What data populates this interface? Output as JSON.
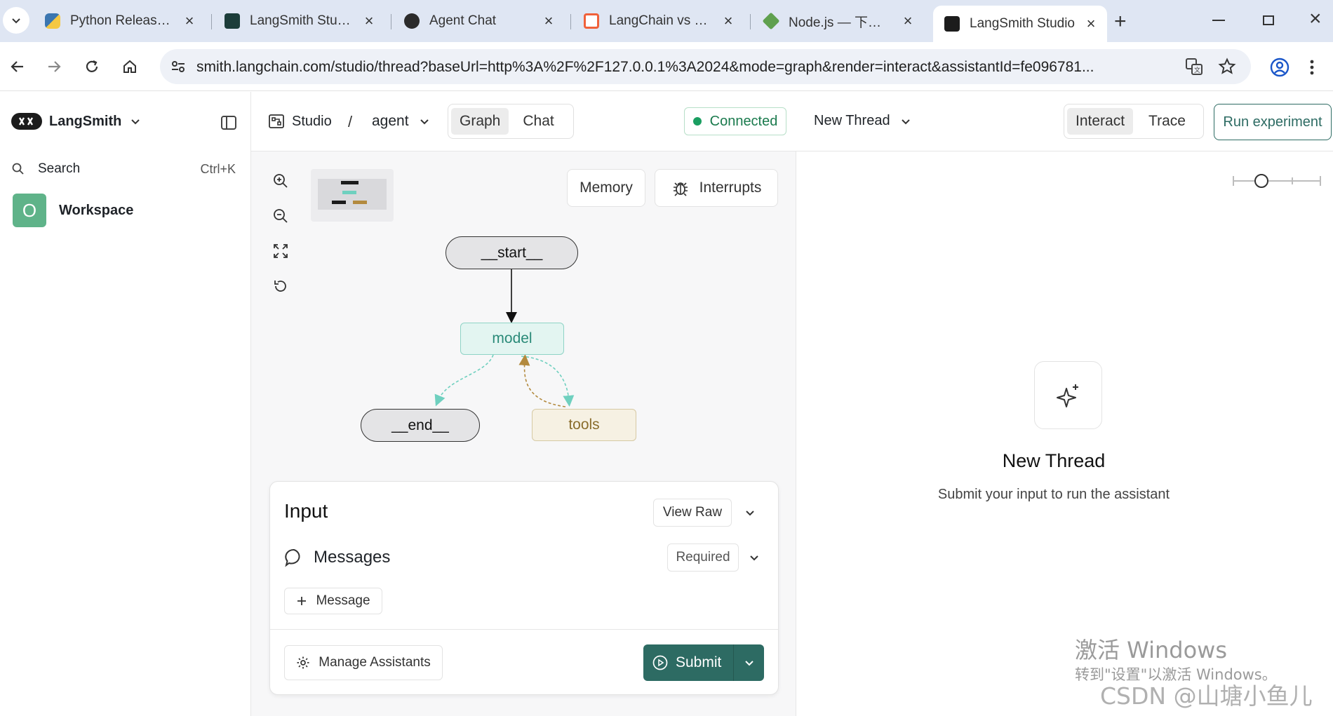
{
  "browser": {
    "tabs": [
      {
        "label": "Python Release P",
        "icon": "python-icon"
      },
      {
        "label": "LangSmith Studio",
        "icon": "langsmith-icon"
      },
      {
        "label": "Agent Chat",
        "icon": "agent-chat-icon"
      },
      {
        "label": "LangChain vs Lan",
        "icon": "langchain-icon"
      },
      {
        "label": "Node.js — 下载 N",
        "icon": "nodejs-icon"
      },
      {
        "label": "LangSmith Studio",
        "icon": "langsmith-icon"
      }
    ],
    "url": "smith.langchain.com/studio/thread?baseUrl=http%3A%2F%2F127.0.0.1%3A2024&mode=graph&render=interact&assistantId=fe096781..."
  },
  "sidebar": {
    "brand": "LangSmith",
    "search_label": "Search",
    "search_shortcut": "Ctrl+K",
    "workspace_initial": "O",
    "workspace_label": "Workspace"
  },
  "header": {
    "studio_label": "Studio",
    "separator": "/",
    "graph_name": "agent",
    "view_tabs": [
      "Graph",
      "Chat"
    ],
    "status": "Connected",
    "thread_label": "New Thread",
    "mode_tabs": [
      "Interact",
      "Trace"
    ],
    "run_experiment": "Run experiment"
  },
  "graph": {
    "memory_label": "Memory",
    "interrupts_label": "Interrupts",
    "nodes": {
      "start": "__start__",
      "model": "model",
      "end": "__end__",
      "tools": "tools"
    }
  },
  "input_panel": {
    "title": "Input",
    "view_raw": "View Raw",
    "messages_label": "Messages",
    "required_label": "Required",
    "add_message": "Message",
    "manage_assistants": "Manage Assistants",
    "submit": "Submit"
  },
  "thread_panel": {
    "title": "New Thread",
    "subtitle": "Submit your input to run the assistant"
  },
  "overlay": {
    "activate_title": "激活 Windows",
    "activate_sub": "转到\"设置\"以激活 Windows。",
    "watermark": "CSDN @山塘小鱼儿"
  },
  "colors": {
    "accent": "#2d6b63",
    "status_green": "#1a9e61",
    "model_fill": "#e3f5f1",
    "model_border": "#8fd3c6",
    "model_text": "#2a8a78",
    "tools_fill": "#f6f1e3",
    "tools_border": "#d6c9a3",
    "tools_text": "#8a6d2c",
    "tab_strip": "#dfe6f3"
  }
}
